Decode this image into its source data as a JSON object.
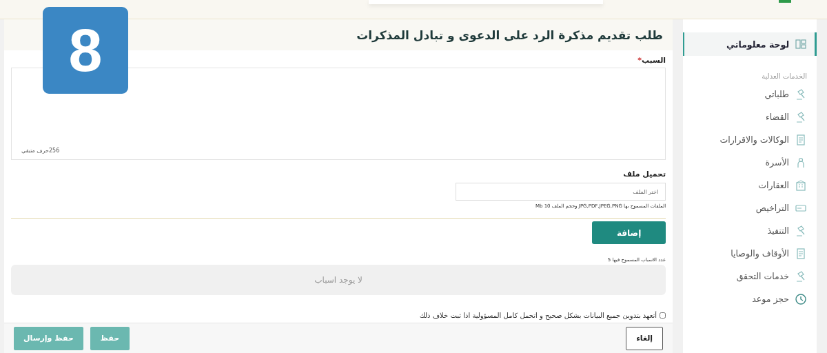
{
  "step_badge": "8",
  "title": "طلب تقديم مذكرة الرد على الدعوى و تبادل المذكرات",
  "reason": {
    "label": "السبب",
    "required_mark": "*",
    "counter": "256حرف متبقي"
  },
  "upload": {
    "label": "تحميل ملف",
    "placeholder": "اختر الملف",
    "hint": "الملفات المسموح بها JPG,PDF,JPEG,PNG وحجم الملف 10 Mb"
  },
  "add_button": "إضافة",
  "reasons_limit": "عدد الاسباب المسموح فيها 5",
  "empty_reasons": "لا يوجد اسباب",
  "pledge": {
    "label": "أتعهد بتدوين جميع البيانات بشكل صحيح و اتحمل كامل المسؤولية اذا ثبت خلاف ذلك",
    "checked": false
  },
  "footer_buttons": [
    {
      "label": "إلغاء",
      "kind": "outline"
    },
    {
      "label": "حفظ",
      "kind": "filled"
    },
    {
      "label": "حفظ وإرسال",
      "kind": "filled"
    }
  ],
  "sidebar": {
    "items": [
      {
        "label": "لوحة معلوماتي",
        "selected": true,
        "kind": "item"
      },
      {
        "label": "الخدمات العدلية",
        "kind": "heading"
      },
      {
        "label": "طلباتي",
        "selected": false,
        "kind": "item"
      },
      {
        "label": "القضاء",
        "selected": false,
        "kind": "item"
      },
      {
        "label": "الوكالات والاقرارات",
        "selected": false,
        "kind": "item"
      },
      {
        "label": "الأسرة",
        "selected": false,
        "kind": "item"
      },
      {
        "label": "العقارات",
        "selected": false,
        "kind": "item"
      },
      {
        "label": "التراخيص",
        "selected": false,
        "kind": "item"
      },
      {
        "label": "التنفيذ",
        "selected": false,
        "kind": "item"
      },
      {
        "label": "الأوقاف والوصايا",
        "selected": false,
        "kind": "item"
      },
      {
        "label": "خدمات التحقق",
        "selected": false,
        "kind": "item"
      },
      {
        "label": "حجز موعد",
        "selected": false,
        "kind": "item"
      }
    ]
  }
}
